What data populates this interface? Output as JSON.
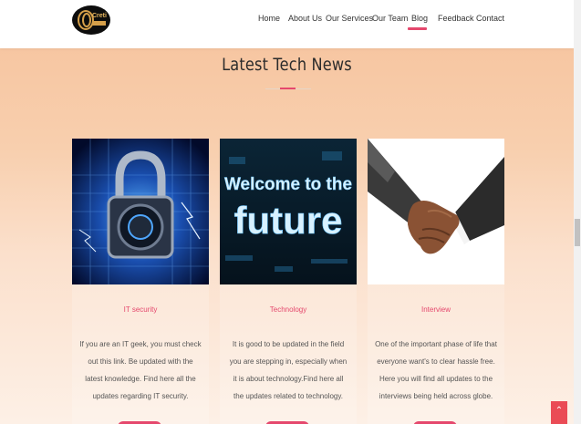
{
  "header": {
    "logo_text": "Creti",
    "nav": [
      {
        "label": "Home"
      },
      {
        "label": "About Us"
      },
      {
        "label": "Our Services"
      },
      {
        "label": "Our Team"
      },
      {
        "label": "Blog"
      },
      {
        "label": "Feedback"
      },
      {
        "label": "Contact"
      }
    ],
    "active_nav": "Blog"
  },
  "section": {
    "title": "Latest Tech News"
  },
  "cards": [
    {
      "title": "IT security",
      "image": "padlock-cyber-image",
      "text": "If you are an IT geek, you must check out this link. Be updated with the latest knowledge. Find here all the updates regarding IT security."
    },
    {
      "title": "Technology",
      "image": "welcome-future-image",
      "text": "It is good to be updated in the field you are stepping in, especially when it is about technology.Find here all the updates related to technology."
    },
    {
      "title": "Interview",
      "image": "handshake-image",
      "text": "One of the important phase of life that everyone want's to clear hassle free. Here you will find all updates to the interviews being held across globe."
    }
  ],
  "image_text": {
    "welcome": "Welcome to the",
    "future": "future"
  },
  "to_top_icon": "chevron-up-icon",
  "colors": {
    "accent": "#e5486d",
    "background_top": "#f6c29c",
    "background_bottom": "#fdf0e6",
    "to_top": "#ea4b55"
  }
}
